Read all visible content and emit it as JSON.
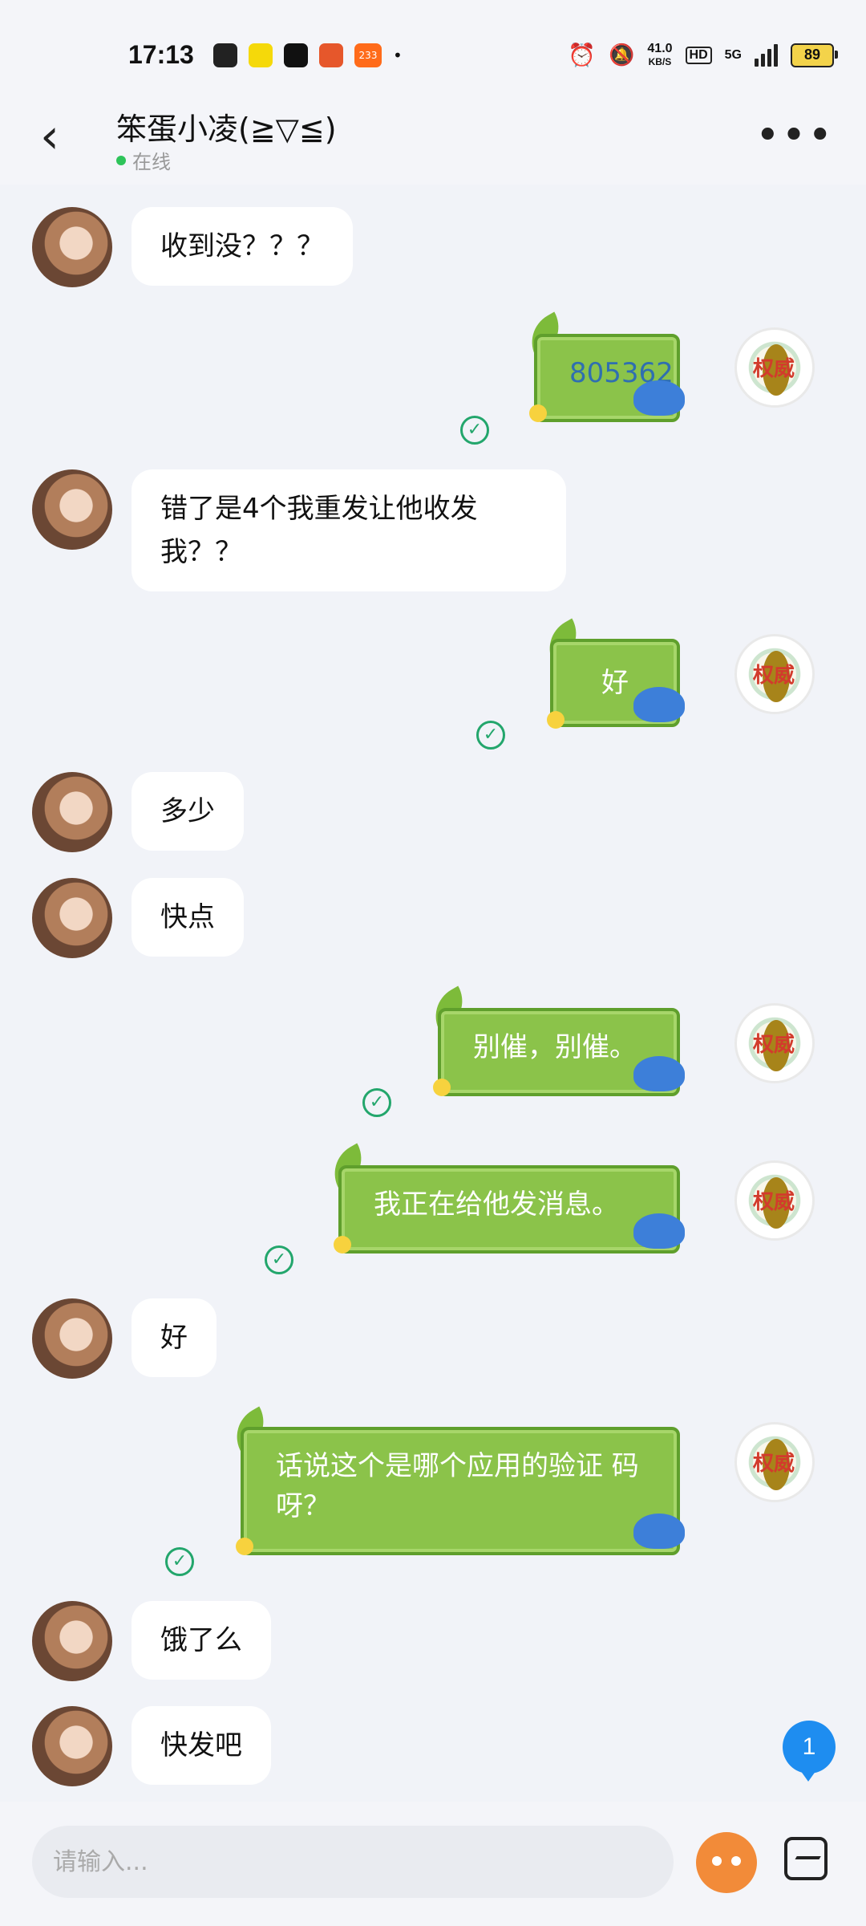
{
  "status_bar": {
    "time": "17:13",
    "net_speed_value": "41.0",
    "net_speed_unit": "KB/S",
    "hd": "HD",
    "network": "5G",
    "battery": "89",
    "app_badge": "233"
  },
  "header": {
    "back_icon": "‹",
    "title": "笨蛋小凌(≧▽≦)",
    "status": "在线",
    "more_icon": "•••"
  },
  "messages": [
    {
      "side": "in",
      "text": "收到没？？？"
    },
    {
      "side": "out",
      "text": "805362"
    },
    {
      "side": "in",
      "text": "错了是4个我重发让他收发\n我？？"
    },
    {
      "side": "out",
      "text": "好"
    },
    {
      "side": "in",
      "text": "多少"
    },
    {
      "side": "in",
      "text": "快点"
    },
    {
      "side": "out",
      "text": "别催，别催。"
    },
    {
      "side": "out",
      "text": "我正在给他发消息。"
    },
    {
      "side": "in",
      "text": "好"
    },
    {
      "side": "out",
      "text": "话说这个是哪个应用的验证\n码呀？"
    },
    {
      "side": "in",
      "text": "饿了么"
    },
    {
      "side": "in",
      "text": "快发吧"
    }
  ],
  "check_icon": "✓",
  "self_avatar_glyph": "权威",
  "float_badge": "1",
  "input": {
    "placeholder": "请输入..."
  }
}
